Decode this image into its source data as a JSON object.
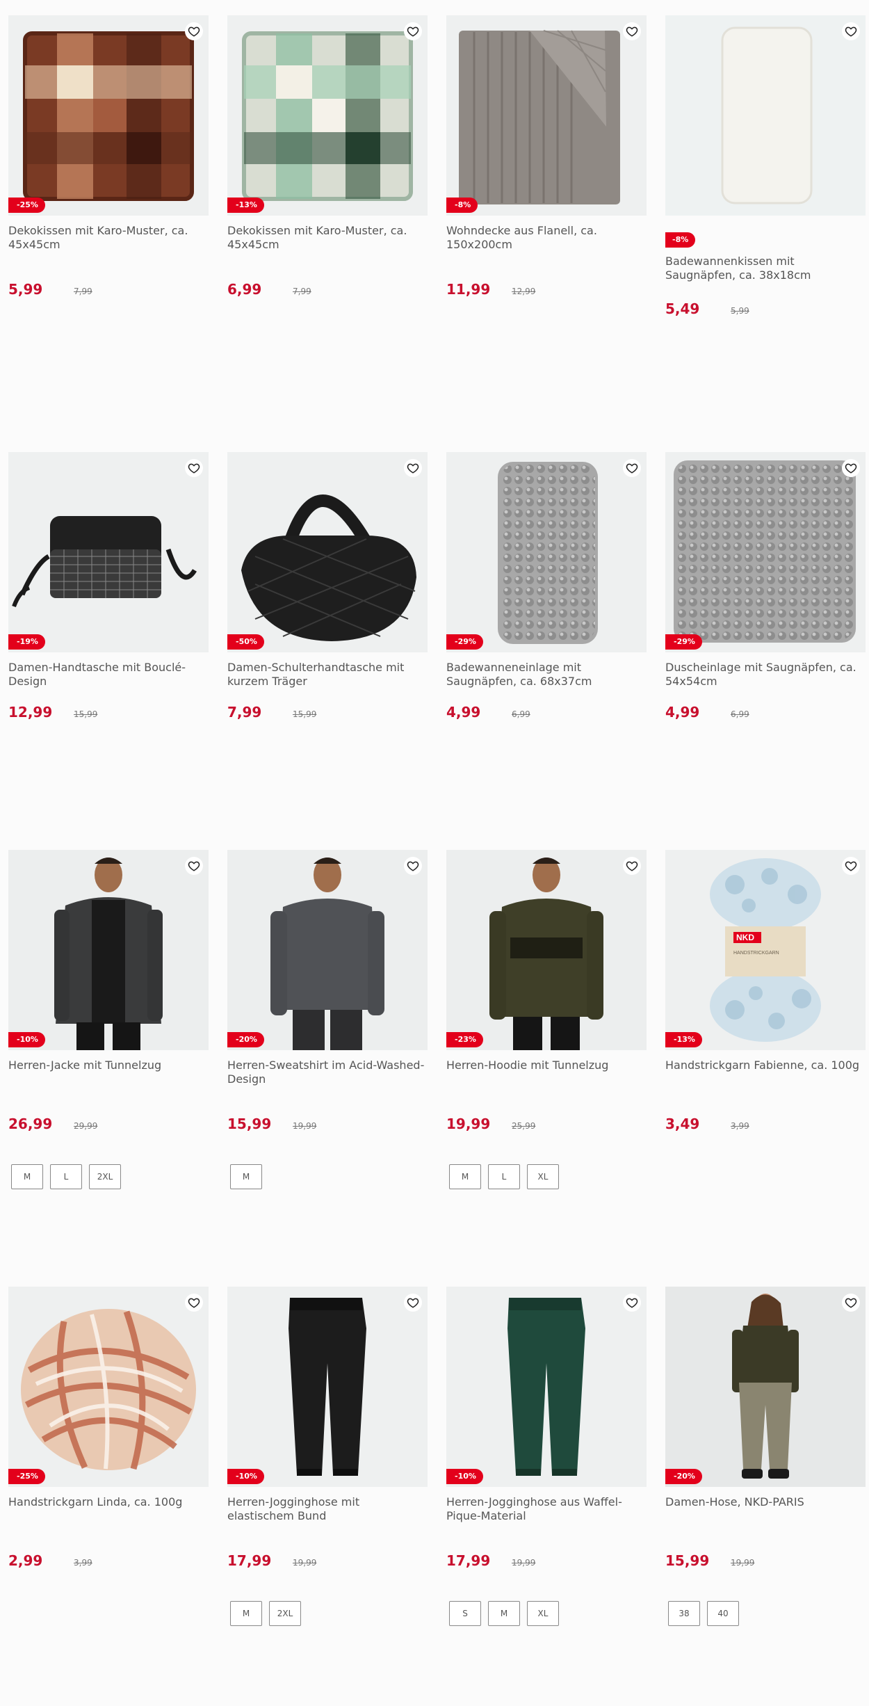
{
  "products": [
    {
      "title": "Dekokissen mit Karo-Muster, ca. 45x45cm",
      "discount": "-25%",
      "price": "5,99",
      "old_price": "7,99",
      "sizes": []
    },
    {
      "title": "Dekokissen mit Karo-Muster, ca. 45x45cm",
      "discount": "-13%",
      "price": "6,99",
      "old_price": "7,99",
      "sizes": []
    },
    {
      "title": "Wohndecke aus Flanell, ca. 150x200cm",
      "discount": "-8%",
      "price": "11,99",
      "old_price": "12,99",
      "sizes": []
    },
    {
      "title": "Badewannenkissen mit Saugnäpfen, ca. 38x18cm",
      "discount": "-8%",
      "price": "5,49",
      "old_price": "5,99",
      "sizes": []
    },
    {
      "title": "Damen-Handtasche mit Bouclé-Design",
      "discount": "-19%",
      "price": "12,99",
      "old_price": "15,99",
      "sizes": []
    },
    {
      "title": "Damen-Schulterhandtasche mit kurzem Träger",
      "discount": "-50%",
      "price": "7,99",
      "old_price": "15,99",
      "sizes": []
    },
    {
      "title": "Badewanneneinlage mit Saugnäpfen, ca. 68x37cm",
      "discount": "-29%",
      "price": "4,99",
      "old_price": "6,99",
      "sizes": []
    },
    {
      "title": "Duscheinlage mit Saugnäpfen, ca. 54x54cm",
      "discount": "-29%",
      "price": "4,99",
      "old_price": "6,99",
      "sizes": []
    },
    {
      "title": "Herren-Jacke mit Tunnelzug",
      "discount": "-10%",
      "price": "26,99",
      "old_price": "29,99",
      "sizes": [
        "M",
        "L",
        "2XL"
      ]
    },
    {
      "title": "Herren-Sweatshirt im Acid-Washed-Design",
      "discount": "-20%",
      "price": "15,99",
      "old_price": "19,99",
      "sizes": [
        "M"
      ]
    },
    {
      "title": "Herren-Hoodie mit Tunnelzug",
      "discount": "-23%",
      "price": "19,99",
      "old_price": "25,99",
      "sizes": [
        "M",
        "L",
        "XL"
      ]
    },
    {
      "title": "Handstrickgarn Fabienne, ca. 100g",
      "discount": "-13%",
      "price": "3,49",
      "old_price": "3,99",
      "sizes": []
    },
    {
      "title": "Handstrickgarn Linda, ca. 100g",
      "discount": "-25%",
      "price": "2,99",
      "old_price": "3,99",
      "sizes": []
    },
    {
      "title": "Herren-Jogginghose mit elastischem Bund",
      "discount": "-10%",
      "price": "17,99",
      "old_price": "19,99",
      "sizes": [
        "M",
        "2XL"
      ]
    },
    {
      "title": "Herren-Jogginghose aus Waffel-Pique-Material",
      "discount": "-10%",
      "price": "17,99",
      "old_price": "19,99",
      "sizes": [
        "S",
        "M",
        "XL"
      ]
    },
    {
      "title": "Damen-Hose, NKD-PARIS",
      "discount": "-20%",
      "price": "15,99",
      "old_price": "19,99",
      "sizes": [
        "38",
        "40"
      ]
    }
  ],
  "images": {
    "yarn_label": "NKD",
    "yarn_label_sub": "HANDSTRICKGARN"
  },
  "colors": {
    "accent": "#c8102e",
    "badge": "#e3001b"
  }
}
